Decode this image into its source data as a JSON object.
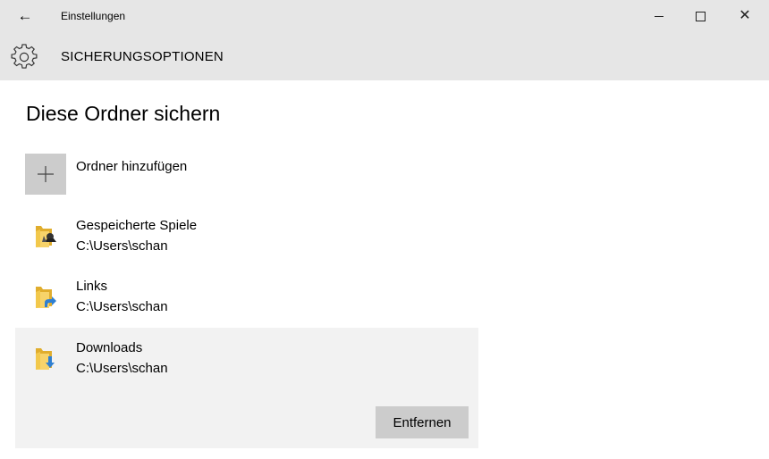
{
  "window": {
    "title": "Einstellungen",
    "back_icon": "back-arrow-icon",
    "controls": {
      "minimize_icon": "minimize-icon",
      "maximize_icon": "maximize-icon",
      "close_icon": "close-icon"
    }
  },
  "header": {
    "icon": "gear-icon",
    "title": "SICHERUNGSOPTIONEN"
  },
  "main": {
    "title": "Diese Ordner sichern",
    "add_folder": {
      "icon": "plus-icon",
      "label": "Ordner hinzufügen"
    },
    "folders": [
      {
        "name": "Gespeicherte Spiele",
        "path": "C:\\Users\\schan",
        "icon": "saved-games-folder-icon",
        "selected": false
      },
      {
        "name": "Links",
        "path": "C:\\Users\\schan",
        "icon": "links-folder-icon",
        "selected": false
      },
      {
        "name": "Downloads",
        "path": "C:\\Users\\schan",
        "icon": "downloads-folder-icon",
        "selected": true
      }
    ],
    "remove_label": "Entfernen"
  },
  "colors": {
    "chrome_background": "#e6e6e6",
    "tile_background": "#cccccc",
    "selected_item_background": "#f2f2f2",
    "folder_yellow": "#f2c84b",
    "accent_blue": "#2f7fd1"
  }
}
